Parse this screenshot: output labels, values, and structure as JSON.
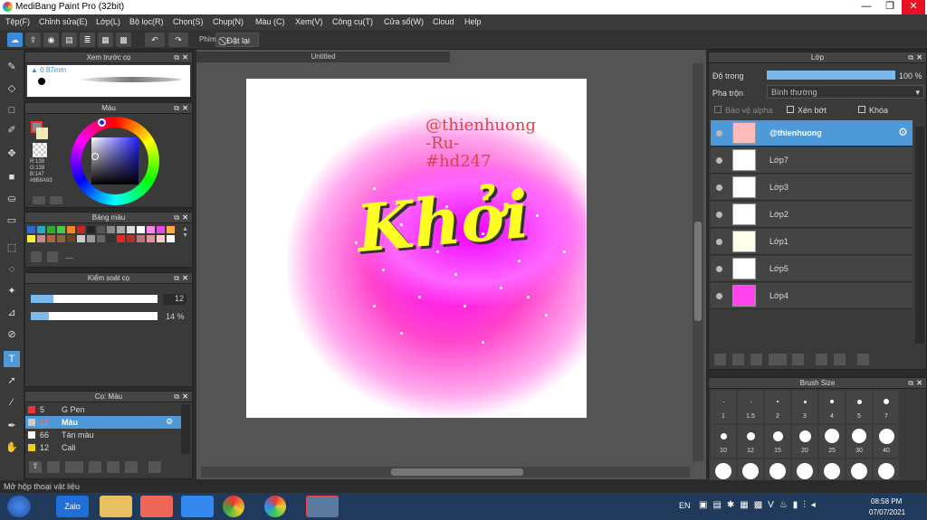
{
  "window": {
    "title": "MediBang Paint Pro (32bit)",
    "min": "—",
    "max": "❐",
    "close": "✕"
  },
  "menu": [
    "Tệp(F)",
    "Chỉnh sửa(E)",
    "Lớp(L)",
    "Bộ lọc(R)",
    "Chọn(S)",
    "Chụp(N)",
    "Màu (C)",
    "Xem(V)",
    "Công cụ(T)",
    "Cửa sổ(W)",
    "Cloud",
    "Help"
  ],
  "toolbar": {
    "phim_label": "Phím",
    "reset_label": "Đặt lại"
  },
  "preview_panel": {
    "title": "Xem trước cọ",
    "size": "0.87mm"
  },
  "color_panel": {
    "title": "Màu",
    "r": "R:139",
    "g": "G:138",
    "b": "B:147",
    "hex": "#8B8A93"
  },
  "palette_panel": {
    "title": "Bảng màu",
    "colors": [
      "#2a6bd8",
      "#2ac",
      "#3a3",
      "#4c4",
      "#e82",
      "#c22",
      "#222",
      "#555",
      "#888",
      "#aaa",
      "#ddd",
      "#fff",
      "#f8e",
      "#e4e",
      "#fa4",
      "#fe4",
      "#c88",
      "#a64",
      "#864",
      "#642",
      "#ccc",
      "#999",
      "#666",
      "#333",
      "#e22",
      "#a33",
      "#b77",
      "#d99",
      "#fcc",
      "#fff"
    ],
    "extra": "---"
  },
  "brush_control": {
    "title": "Kiểm soát cọ",
    "size_value": "12",
    "opacity_value": "14 %",
    "size_fraction": 0.18,
    "opacity_fraction": 0.14
  },
  "brush_list": {
    "title": "Cọ: Màu",
    "items": [
      {
        "size": "5",
        "name": "G Pen",
        "color": "#e33"
      },
      {
        "size": "12",
        "name": "Màu",
        "color": "#ccc"
      },
      {
        "size": "66",
        "name": "Tán màu",
        "color": "#fff"
      },
      {
        "size": "12",
        "name": "Cali",
        "color": "#ec2"
      }
    ]
  },
  "canvas": {
    "tab": "Untitled",
    "watermark_lines": [
      "@thienhuong",
      "-Ru-",
      "#hd247"
    ],
    "art_text": "Khởi"
  },
  "layer_panel": {
    "title": "Lớp",
    "opacity_label": "Độ trong",
    "opacity_value": "100 %",
    "opacity_fraction": 1.0,
    "blend_label": "Pha trộn",
    "blend_value": "Bình thường",
    "alpha_label": "Bảo vệ alpha",
    "clip_label": "Xén bớt",
    "lock_label": "Khóa",
    "layers": [
      "@thienhuong",
      "Lớp7",
      "Lớp3",
      "Lớp2",
      "Lớp1",
      "Lớp5",
      "Lớp4"
    ]
  },
  "brush_size_panel": {
    "title": "Brush Size",
    "sizes_row1": [
      "1",
      "1.5",
      "2",
      "3",
      "4",
      "5",
      "7"
    ],
    "sizes_row2": [
      "10",
      "12",
      "15",
      "20",
      "25",
      "30",
      "40"
    ]
  },
  "status": "Mở hộp thoại vật liệu",
  "taskbar": {
    "lang": "EN",
    "time": "08:58 PM",
    "date": "07/07/2021",
    "zalo": "Zalo"
  }
}
